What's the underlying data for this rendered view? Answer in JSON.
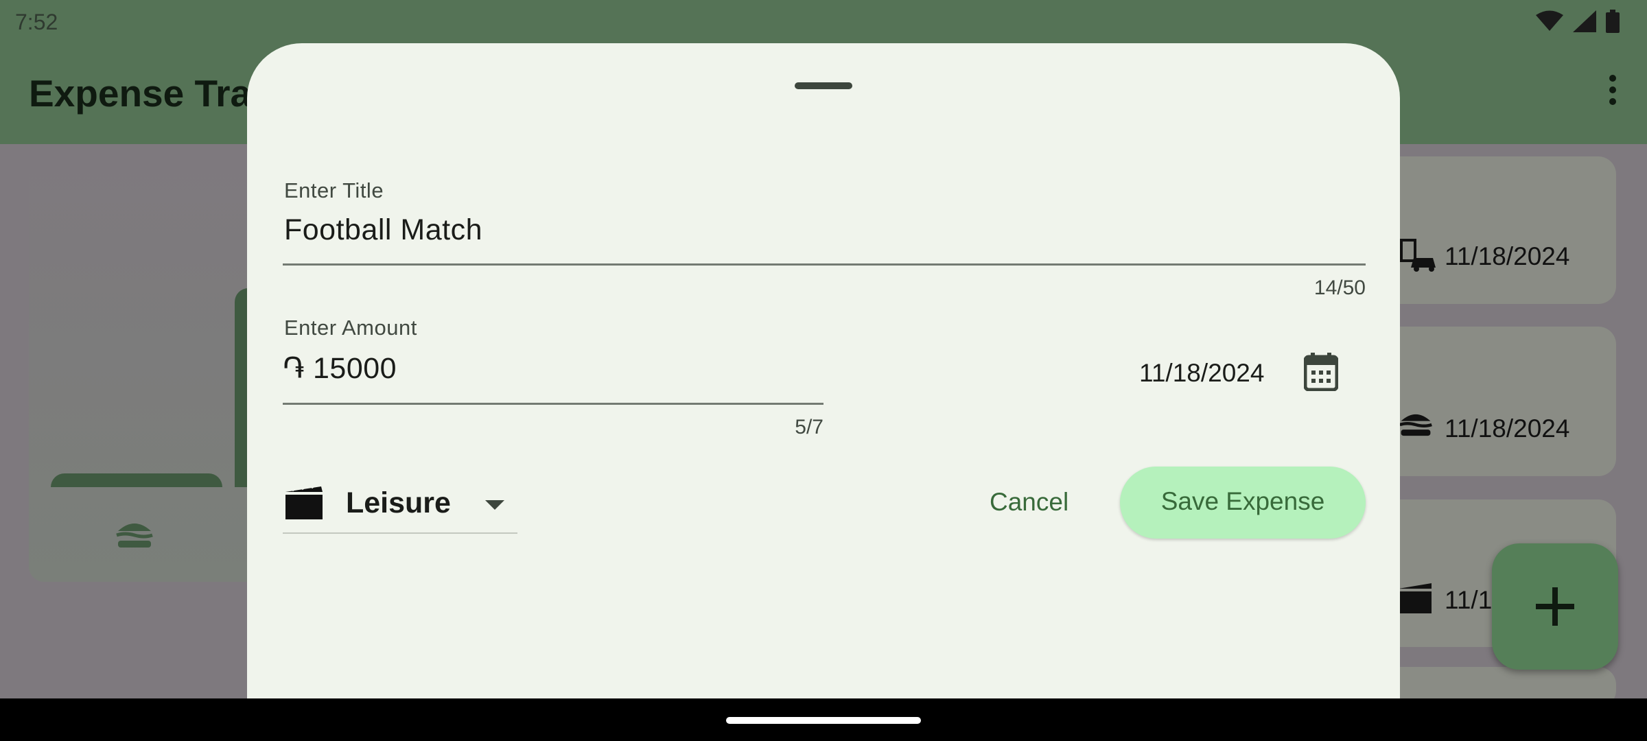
{
  "status_bar": {
    "time": "7:52",
    "icons": [
      "wifi-icon",
      "signal-icon",
      "battery-icon"
    ]
  },
  "app_bar": {
    "title": "Expense Tracker",
    "menu_icon": "more-vert-icon"
  },
  "background_list": [
    {
      "date": "11/18/2024",
      "icon": "travel-icon"
    },
    {
      "date": "11/18/2024",
      "icon": "food-icon"
    },
    {
      "date": "11/1",
      "icon": "leisure-icon"
    }
  ],
  "chart_icons": [
    "food-icon"
  ],
  "fab": {
    "icon": "add-icon"
  },
  "sheet": {
    "title_field": {
      "label": "Enter Title",
      "value": "Football Match",
      "counter": "14/50"
    },
    "amount_field": {
      "label": "Enter Amount",
      "currency_symbol": "֏",
      "value": "15000",
      "counter": "5/7"
    },
    "date": {
      "value": "11/18/2024",
      "icon": "calendar-icon"
    },
    "category": {
      "selected": "Leisure",
      "icon": "movie-icon"
    },
    "cancel_label": "Cancel",
    "save_label": "Save Expense"
  },
  "colors": {
    "app_bar": "#557356",
    "sheet_background": "#f0f4ec",
    "accent": "#386a3a",
    "save_button": "#b5f1bc",
    "fab": "#557f58"
  }
}
